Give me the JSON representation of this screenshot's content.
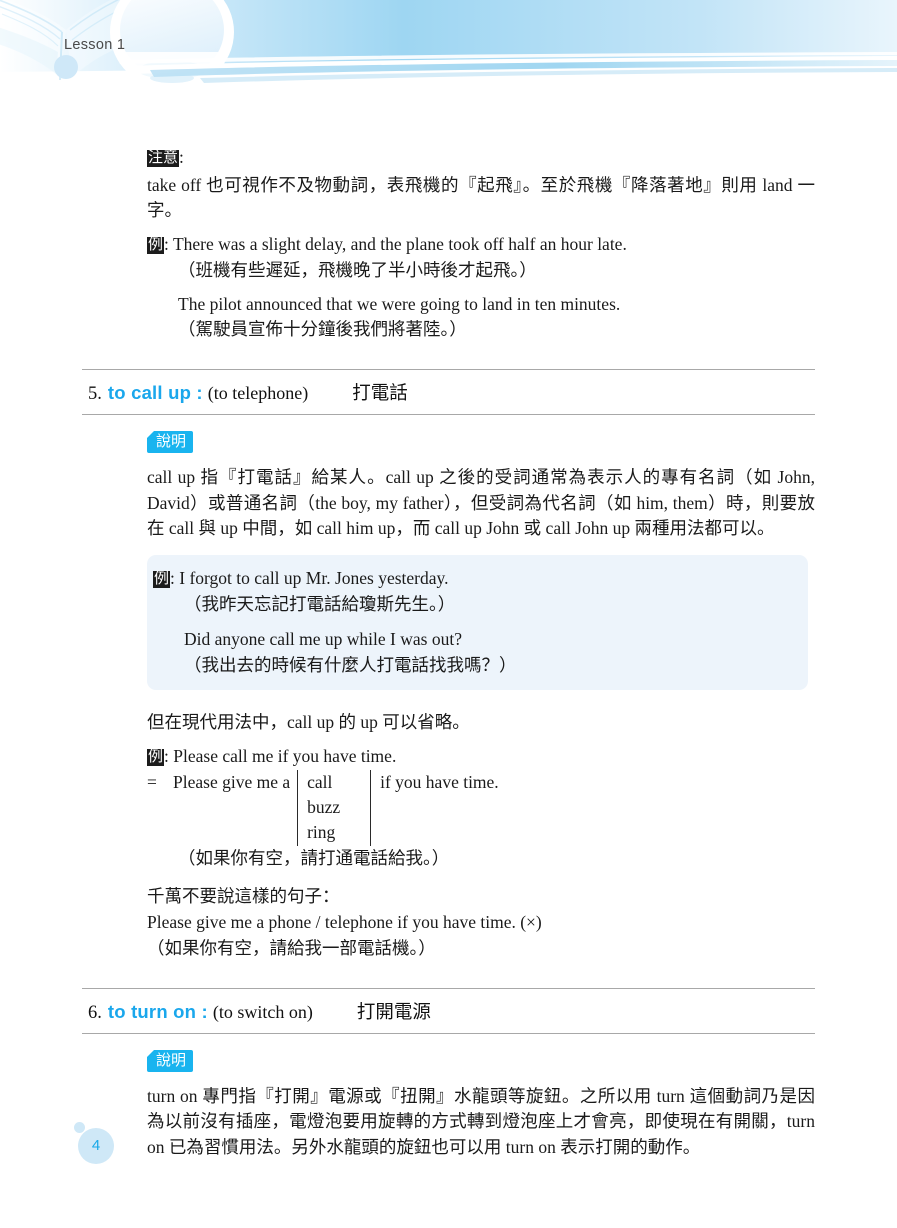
{
  "header": {
    "lesson_label": "Lesson 1",
    "accent_color": "#a6d9f2",
    "book_icon": "open-book-icon"
  },
  "note_block": {
    "marker": "注意",
    "marker_suffix": ":",
    "body": "take off 也可視作不及物動詞，表飛機的『起飛』。至於飛機『降落著地』則用 land 一字。",
    "example_marker": "例",
    "example_marker_suffix": ":",
    "examples": [
      {
        "en": "There was a slight delay, and the plane took off half an hour late.",
        "zh": "（班機有些遲延，飛機晚了半小時後才起飛。）"
      },
      {
        "en": "The pilot announced that we were going to land in ten minutes.",
        "zh": "（駕駛員宣佈十分鐘後我們將著陸。）"
      }
    ]
  },
  "sections": [
    {
      "number": "5.",
      "term": "to call up :",
      "gloss": "(to telephone)",
      "chinese": "打電話",
      "explain_badge": "說明",
      "explanation": "call up 指『打電話』給某人。call up 之後的受詞通常為表示人的專有名詞（如 John, David）或普通名詞（the boy, my father），但受詞為代名詞（如 him, them）時，則要放在 call 與 up 中間，如 call him up，而 call up John 或 call John up 兩種用法都可以。",
      "example_box": {
        "marker": "例",
        "marker_suffix": ":",
        "items": [
          {
            "en": "I forgot to call up Mr. Jones yesterday.",
            "zh": "（我昨天忘記打電話給瓊斯先生。）"
          },
          {
            "en": "Did anyone call me up while I was out?",
            "zh": "（我出去的時候有什麼人打電話找我嗎？）"
          }
        ]
      },
      "followup_note": "但在現代用法中，call up 的 up 可以省略。",
      "second_example": {
        "marker": "例",
        "marker_suffix": ":",
        "en": "Please call me if you have time."
      },
      "alternatives": {
        "equals": "=",
        "lead": "Please give me a",
        "options": [
          "call",
          "buzz",
          "ring"
        ],
        "tail": "if you have time.",
        "zh": "（如果你有空，請打通電話給我。）"
      },
      "warning": {
        "intro": "千萬不要說這樣的句子：",
        "sentence": "Please give me a phone / telephone if you have time. (×)",
        "zh": "（如果你有空，請給我一部電話機。）"
      }
    },
    {
      "number": "6.",
      "term": "to turn on :",
      "gloss": "(to switch on)",
      "chinese": "打開電源",
      "explain_badge": "說明",
      "explanation": "turn on 專門指『打開』電源或『扭開』水龍頭等旋鈕。之所以用 turn 這個動詞乃是因為以前沒有插座，電燈泡要用旋轉的方式轉到燈泡座上才會亮，即使現在有開關，turn on 已為習慣用法。另外水龍頭的旋鈕也可以用 turn on 表示打開的動作。"
    }
  ],
  "footer": {
    "page_number": "4",
    "page_number_color": "#19a9e8"
  }
}
